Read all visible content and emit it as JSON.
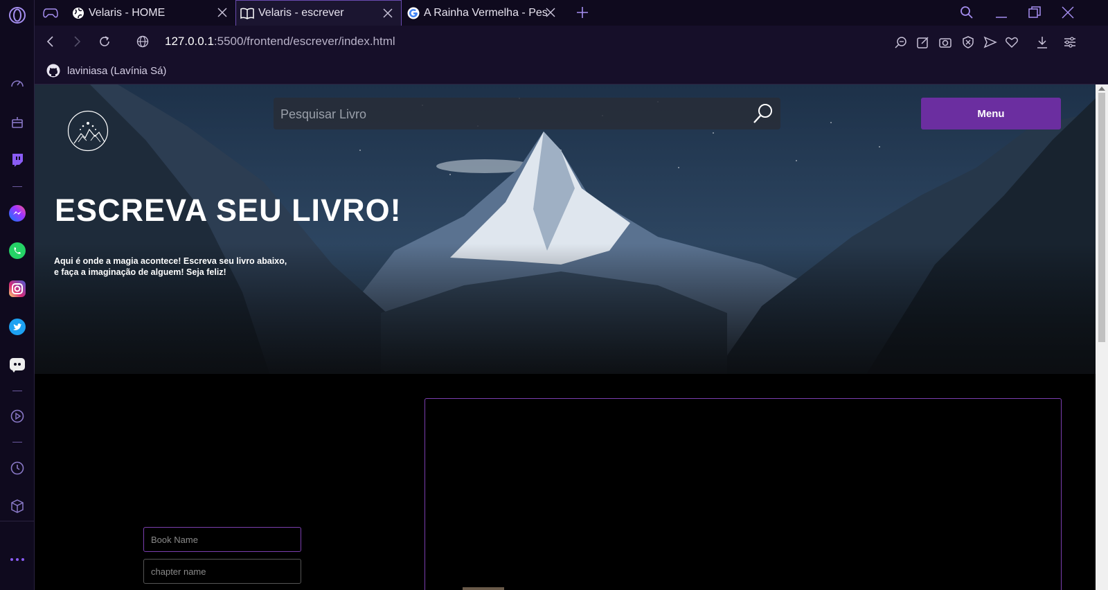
{
  "browser": {
    "tabs": [
      {
        "title": "Velaris - HOME"
      },
      {
        "title": "Velaris - escrever"
      },
      {
        "title": "A Rainha Vermelha - Pesqu"
      }
    ],
    "url_host": "127.0.0.1",
    "url_rest": ":5500/frontend/escrever/index.html",
    "bookmark": "laviniasa (Lavínia Sá)"
  },
  "page": {
    "search_placeholder": "Pesquisar Livro",
    "menu_label": "Menu",
    "heading": "ESCREVA SEU LIVRO!",
    "subtitle_line1": "Aqui é onde a magia acontece! Escreva seu livro abaixo,",
    "subtitle_line2": "e faça a imaginação de alguem! Seja feliz!",
    "book_name_placeholder": "Book Name",
    "chapter_name_placeholder": "chapter name"
  },
  "colors": {
    "accent": "#6b2ea0",
    "border_purple": "#7b3fb0",
    "browser_bg": "#0f0a1e"
  }
}
